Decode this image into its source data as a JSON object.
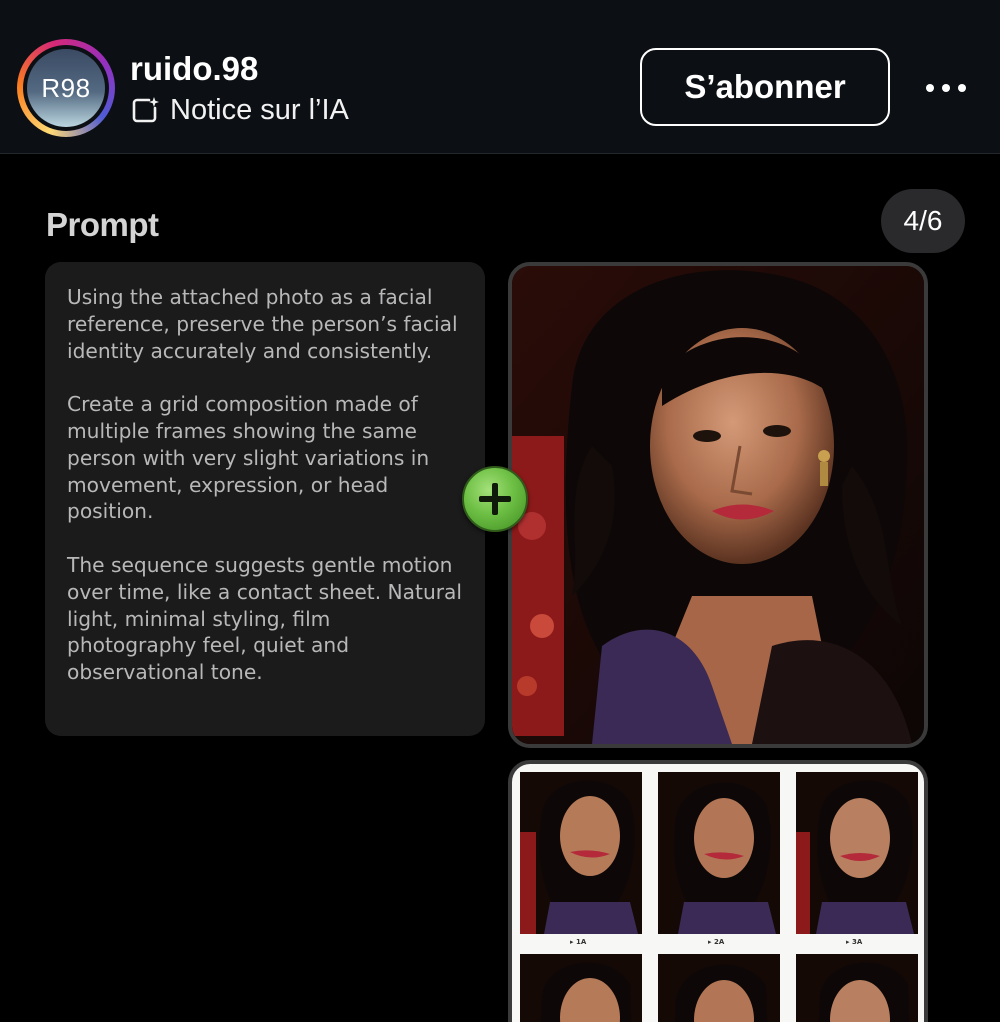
{
  "header": {
    "avatar_text": "R98",
    "username": "ruido.98",
    "ai_notice": "Notice sur l’IA",
    "follow_label": "S’abonner",
    "more_icon": "more-horizontal-icon"
  },
  "content": {
    "section_title": "Prompt",
    "counter": "4/6",
    "prompt_paragraphs": [
      "Using the attached photo as a facial reference, preserve the person’s facial identity accurately and consistently.",
      "Create a grid composition made of multiple frames showing the same person with very slight variations in movement, expression, or head position.",
      "The sequence suggests gentle motion over time, like a contact sheet. Natural light, minimal styling, film photography feel, quiet and observational tone."
    ],
    "plus_icon": "plus-circle-icon",
    "grid_labels": [
      "▸ 1A",
      "▸ 2A",
      "▸ 3A"
    ]
  },
  "colors": {
    "header_bg": "#0c1014",
    "page_bg": "#000000",
    "card_bg": "#1b1b1c",
    "plus_green": "#6dbf44"
  }
}
